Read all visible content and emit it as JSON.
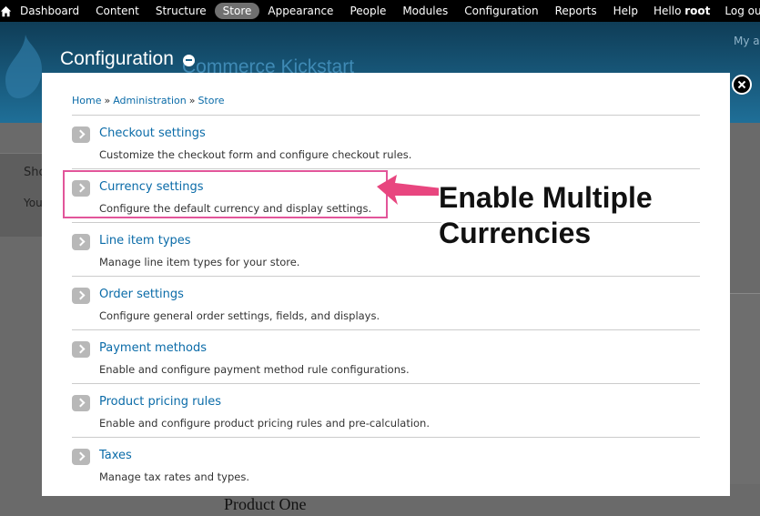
{
  "toolbar": {
    "items": [
      "Dashboard",
      "Content",
      "Structure",
      "Store",
      "Appearance",
      "People",
      "Modules",
      "Configuration",
      "Reports",
      "Help"
    ],
    "active": "Store",
    "hello_prefix": "Hello",
    "hello_user": "root",
    "logout": "Log out"
  },
  "header": {
    "site_name": "Commerce Kickstart",
    "my_account": "My a"
  },
  "background": {
    "show_text": "Sho",
    "you_text": "You",
    "product_title": "Product One"
  },
  "overlay": {
    "title": "Configuration"
  },
  "breadcrumb": [
    "Home",
    "Administration",
    "Store"
  ],
  "breadcrumb_separator": "»",
  "menu_items": [
    {
      "title": "Checkout settings",
      "description": "Customize the checkout form and configure checkout rules."
    },
    {
      "title": "Currency settings",
      "description": "Configure the default currency and display settings."
    },
    {
      "title": "Line item types",
      "description": "Manage line item types for your store."
    },
    {
      "title": "Order settings",
      "description": "Configure general order settings, fields, and displays."
    },
    {
      "title": "Payment methods",
      "description": "Enable and configure payment method rule configurations."
    },
    {
      "title": "Product pricing rules",
      "description": "Enable and configure product pricing rules and pre-calculation."
    },
    {
      "title": "Taxes",
      "description": "Manage tax rates and types."
    }
  ],
  "annotation": {
    "line1": "Enable Multiple",
    "line2": "Currencies"
  },
  "colors": {
    "link": "#0a6ba8",
    "highlight": "#e2559a",
    "arrow": "#e8467f",
    "header": "#1a5f86"
  }
}
